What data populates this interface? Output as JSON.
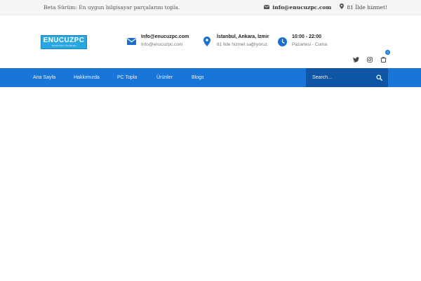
{
  "topbar": {
    "tagline": "Beta Sürüm: En uygun bilgisayar parçalarını topla.",
    "email": "info@enucuzpc.com",
    "service": "81 İlde hizmet!"
  },
  "logo": {
    "name": "ENUCUZPC",
    "tagline": "TEKNOLOJİK ÇÖZÜMLERİ"
  },
  "contact": {
    "email_title": "Info@enucuzpc.com",
    "email_sub": "Info@enucuzpc.com",
    "location_title": "İstanbul, Ankara, İzmir",
    "location_sub": "81 İlde hizmet sağlıyoruz.",
    "hours_title": "10:00 - 22:00",
    "hours_sub": "Pazartesi - Cuma"
  },
  "cart": {
    "count": "0"
  },
  "nav": {
    "items": [
      {
        "label": "Ana Sayfa"
      },
      {
        "label": "Hakkımızda"
      },
      {
        "label": "PC Topla"
      },
      {
        "label": "Ürünler"
      },
      {
        "label": "Blogs"
      }
    ]
  },
  "search": {
    "placeholder": "Search..."
  },
  "colors": {
    "primary": "#1876d8",
    "search_bg": "#0f55a5",
    "logo_bg": "#29a7e1"
  }
}
